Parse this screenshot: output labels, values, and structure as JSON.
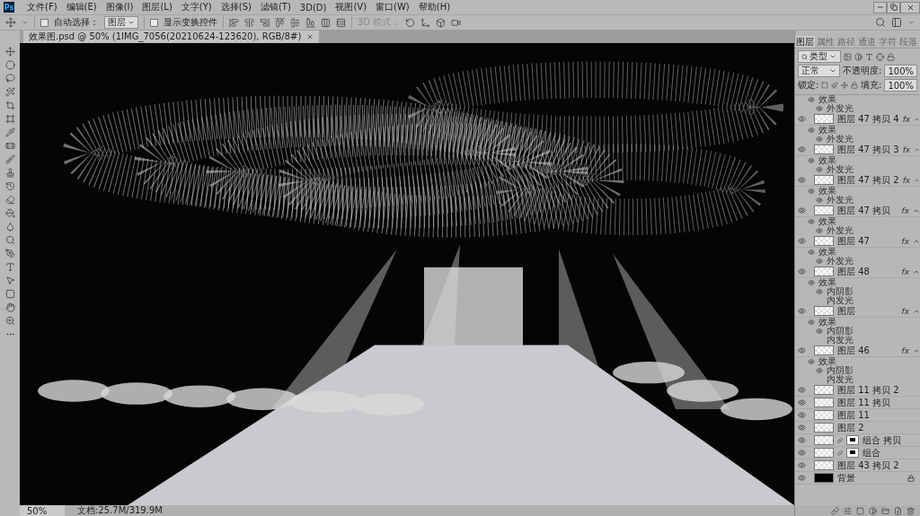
{
  "app": {
    "logo": "Ps"
  },
  "menu": [
    "文件(F)",
    "编辑(E)",
    "图像(I)",
    "图层(L)",
    "文字(Y)",
    "选择(S)",
    "滤镜(T)",
    "3D(D)",
    "视图(V)",
    "窗口(W)",
    "帮助(H)"
  ],
  "options_bar": {
    "auto_select": {
      "label": "自动选择：",
      "checked": false
    },
    "auto_select_target": "图层",
    "show_transform": {
      "label": "显示变换控件",
      "checked": false
    },
    "mode_3d_label": "3D 模式："
  },
  "document_tab": {
    "title": "效果图.psd @ 50% (1IMG_7056(20210624-123620), RGB/8#)"
  },
  "layers_panel": {
    "tabs": [
      {
        "label": "图层",
        "selected": true
      },
      {
        "label": "属性",
        "selected": false
      },
      {
        "label": "路径",
        "selected": false
      },
      {
        "label": "通道",
        "selected": false
      },
      {
        "label": "字符",
        "selected": false
      },
      {
        "label": "段落",
        "selected": false
      }
    ],
    "filter": "类型",
    "blend_mode": "正常",
    "opacity_label": "不透明度:",
    "opacity": "100%",
    "lock_label": "锁定:",
    "fill_label": "填充:",
    "fill": "100%",
    "layers": [
      {
        "kind": "continued",
        "effects": [
          {
            "label": "效果",
            "visible": true,
            "children": [
              {
                "label": "外发光",
                "visible": true
              }
            ]
          }
        ]
      },
      {
        "kind": "pixel",
        "name": "图层 47 拷贝 4",
        "visible": true,
        "locked": false,
        "fx": "fx",
        "effects": [
          {
            "label": "效果",
            "visible": true,
            "children": [
              {
                "label": "外发光",
                "visible": true
              }
            ]
          }
        ]
      },
      {
        "kind": "pixel",
        "name": "图层 47 拷贝 3",
        "visible": true,
        "locked": false,
        "fx": "fx",
        "effects": [
          {
            "label": "效果",
            "visible": true,
            "children": [
              {
                "label": "外发光",
                "visible": true
              }
            ]
          }
        ]
      },
      {
        "kind": "pixel",
        "name": "图层 47 拷贝 2",
        "visible": true,
        "locked": false,
        "fx": "fx",
        "effects": [
          {
            "label": "效果",
            "visible": true,
            "children": [
              {
                "label": "外发光",
                "visible": true
              }
            ]
          }
        ]
      },
      {
        "kind": "pixel",
        "name": "图层 47 拷贝",
        "visible": true,
        "locked": false,
        "fx": "fx",
        "effects": [
          {
            "label": "效果",
            "visible": true,
            "children": [
              {
                "label": "外发光",
                "visible": true
              }
            ]
          }
        ]
      },
      {
        "kind": "pixel",
        "name": "图层 47",
        "visible": true,
        "locked": false,
        "fx": "fx",
        "effects": [
          {
            "label": "效果",
            "visible": true,
            "children": [
              {
                "label": "外发光",
                "visible": true
              }
            ]
          }
        ]
      },
      {
        "kind": "pixel",
        "name": "图层 48",
        "visible": true,
        "locked": false,
        "fx": "fx",
        "effects": [
          {
            "label": "效果",
            "visible": true,
            "children": [
              {
                "label": "内阴影",
                "visible": true
              },
              {
                "label": "内发光",
                "visible": false
              }
            ]
          }
        ]
      },
      {
        "kind": "pixel",
        "name": "图层",
        "visible": true,
        "locked": false,
        "fx": "fx",
        "effects": [
          {
            "label": "效果",
            "visible": true,
            "children": [
              {
                "label": "内阴影",
                "visible": true
              },
              {
                "label": "内发光",
                "visible": false
              }
            ]
          }
        ]
      },
      {
        "kind": "pixel",
        "name": "图层 46",
        "visible": true,
        "locked": false,
        "fx": "fx",
        "effects": [
          {
            "label": "效果",
            "visible": true,
            "children": [
              {
                "label": "内阴影",
                "visible": true
              },
              {
                "label": "内发光",
                "visible": false
              }
            ]
          }
        ]
      },
      {
        "kind": "pixel",
        "name": "图层 11 拷贝 2",
        "visible": true,
        "locked": false
      },
      {
        "kind": "pixel",
        "name": "图层 11 拷贝",
        "visible": true,
        "locked": false
      },
      {
        "kind": "pixel",
        "name": "图层 11",
        "visible": true,
        "locked": false
      },
      {
        "kind": "pixel",
        "name": "图层 2",
        "visible": true,
        "locked": false
      },
      {
        "kind": "masked",
        "name": "组合 拷贝",
        "visible": true,
        "locked": false
      },
      {
        "kind": "masked",
        "name": "组合",
        "visible": true,
        "locked": false
      },
      {
        "kind": "pixel",
        "name": "图层 43 拷贝 2",
        "visible": true,
        "locked": false
      },
      {
        "kind": "background",
        "name": "背景",
        "visible": true,
        "locked": true
      }
    ]
  },
  "status_bar": {
    "zoom": "50%",
    "doc": "文档:25.7M/319.9M"
  }
}
